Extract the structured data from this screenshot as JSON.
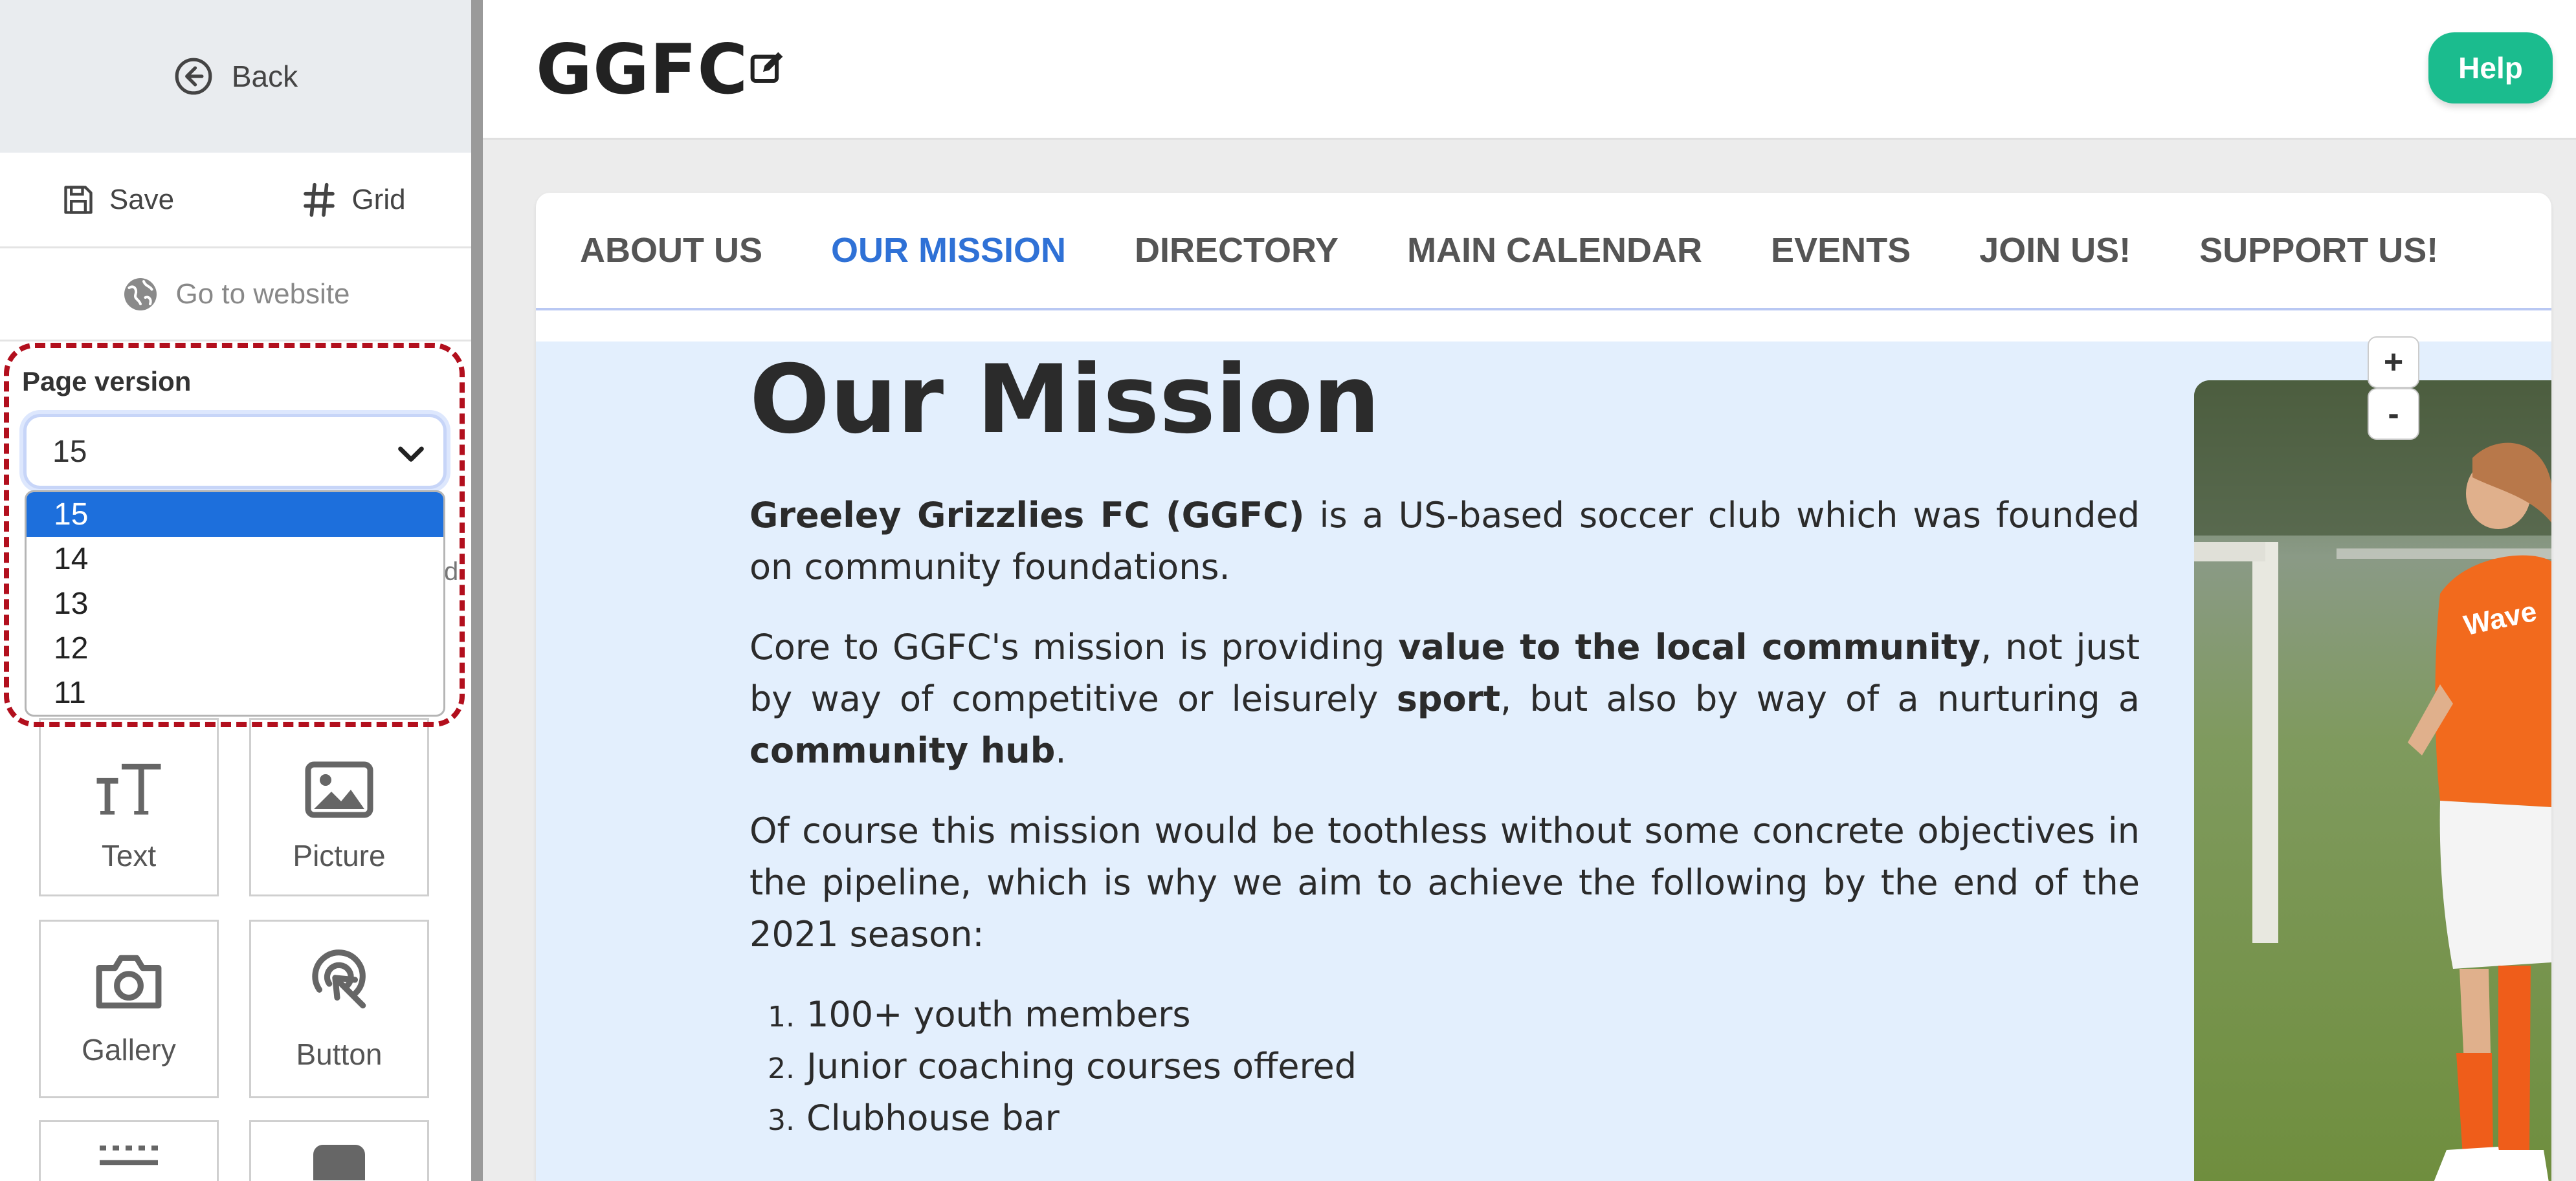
{
  "sidebar": {
    "back_label": "Back",
    "save_label": "Save",
    "grid_label": "Grid",
    "go_to_website_label": "Go to website",
    "page_version": {
      "label": "Page version",
      "selected": "15",
      "options": [
        "15",
        "14",
        "13",
        "12",
        "11"
      ]
    },
    "hidden_text_fragment": "d",
    "widgets": {
      "text": "Text",
      "picture": "Picture",
      "gallery": "Gallery",
      "button": "Button"
    }
  },
  "header": {
    "site_title": "GGFC",
    "help_label": "Help"
  },
  "nav": {
    "items": [
      "ABOUT US",
      "OUR MISSION",
      "DIRECTORY",
      "MAIN CALENDAR",
      "EVENTS",
      "JOIN US!",
      "SUPPORT US!"
    ],
    "active": "OUR MISSION"
  },
  "content": {
    "heading": "Our Mission",
    "p1_bold": "Greeley Grizzlies FC (GGFC)",
    "p1_rest": " is a US-based soccer club which was founded on community foundations.",
    "p2_a": "Core to GGFC's mission is providing ",
    "p2_b": "value to the local community",
    "p2_c": ", not just by way of competitive or leisurely ",
    "p2_d": "sport",
    "p2_e": ", but also by way of a nurturing a ",
    "p2_f": "community hub",
    "p2_g": ".",
    "p3": "Of course this mission would be toothless without some concrete objectives in the pipeline, which is why we aim to achieve the following by the end of the 2021 season:",
    "goals": [
      "100+ youth members",
      "Junior coaching courses offered",
      "Clubhouse bar"
    ],
    "zoom_in": "+",
    "zoom_out": "-",
    "photo_jersey_text": "Wave"
  },
  "colors": {
    "accent": "#2f71d6",
    "help": "#1bbc8e",
    "highlight_border": "#b20f1d",
    "section_bg": "#e3effd",
    "dropdown_selected": "#1d6fdc"
  }
}
